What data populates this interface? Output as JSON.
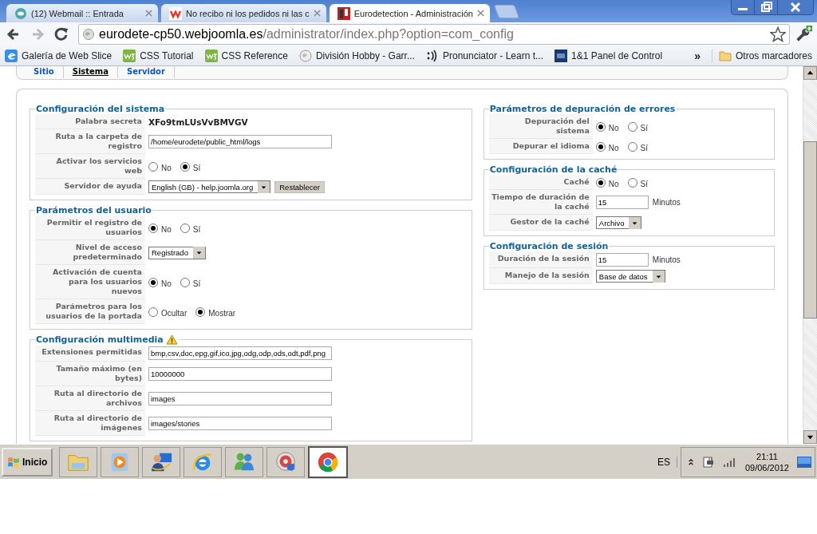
{
  "browser_tabs": [
    {
      "title": "(12) Webmail :: Entrada",
      "selected": false
    },
    {
      "title": "No recibo ni los pedidos ni las c",
      "selected": false
    },
    {
      "title": "Eurodetection - Administración",
      "selected": true
    }
  ],
  "address": {
    "host": "eurodete-cp50.webjoomla.es",
    "path": "/administrator/index.php?option=com_config"
  },
  "bookmarks": [
    {
      "label": "Galería de Web Slice"
    },
    {
      "label": "CSS Tutorial"
    },
    {
      "label": "CSS Reference"
    },
    {
      "label": "División Hobby - Garr..."
    },
    {
      "label": "Pronunciator - Learn t..."
    },
    {
      "label": "1&1 Panel de Control"
    }
  ],
  "bookmarks_overflow": "»",
  "other_bookmarks": "Otros marcadores",
  "config_tabs": [
    {
      "label": "Sitio",
      "selected": false
    },
    {
      "label": "Sistema",
      "selected": true
    },
    {
      "label": "Servidor",
      "selected": false
    }
  ],
  "left_sections": [
    {
      "title": "Configuración del sistema",
      "warning": false,
      "rows": [
        {
          "kind": "text",
          "label": "Palabra secreta",
          "value": "XFo9tmLUsVvBMVGV"
        },
        {
          "kind": "input",
          "label": "Ruta a la carpeta de registro",
          "value": "/home/eurodete/public_html/logs"
        },
        {
          "kind": "radio",
          "label": "Activar los servicios web",
          "options": [
            {
              "label": "No",
              "selected": false
            },
            {
              "label": "Sí",
              "selected": true
            }
          ]
        },
        {
          "kind": "select",
          "label": "Servidor de ayuda",
          "value": "English (GB) - help.joomla.org",
          "button": "Restablecer"
        }
      ]
    },
    {
      "title": "Parámetros del usuario",
      "warning": false,
      "rows": [
        {
          "kind": "radio",
          "label": "Permitir el registro de usuarios",
          "options": [
            {
              "label": "No",
              "selected": true
            },
            {
              "label": "Sí",
              "selected": false
            }
          ]
        },
        {
          "kind": "select",
          "label": "Nivel de acceso predeterminado",
          "value": "Registrado"
        },
        {
          "kind": "radio",
          "label": "Activación de cuenta para los usuarios nuevos",
          "options": [
            {
              "label": "No",
              "selected": true
            },
            {
              "label": "Sí",
              "selected": false
            }
          ]
        },
        {
          "kind": "radio",
          "label": "Parámetros para los usuarios de la portada",
          "options": [
            {
              "label": "Ocultar",
              "selected": false
            },
            {
              "label": "Mostrar",
              "selected": true
            }
          ]
        }
      ]
    },
    {
      "title": "Configuración multimedia",
      "warning": true,
      "rows": [
        {
          "kind": "input",
          "label": "Extensiones permitidas",
          "value": "bmp,csv,doc,epg,gif,ico,jpg,odg,odp,ods,odt,pdf,png"
        },
        {
          "kind": "input",
          "label": "Tamaño máximo (en bytes)",
          "value": "10000000"
        },
        {
          "kind": "input",
          "label": "Ruta al directorio de archivos",
          "value": "images"
        },
        {
          "kind": "input",
          "label": "Ruta al directorio de imágenes",
          "value": "images/stories"
        }
      ]
    }
  ],
  "right_sections": [
    {
      "title": "Parámetros de depuración de errores",
      "warning": false,
      "rows": [
        {
          "kind": "radio",
          "label": "Depuración del sistema",
          "options": [
            {
              "label": "No",
              "selected": true
            },
            {
              "label": "Sí",
              "selected": false
            }
          ]
        },
        {
          "kind": "radio",
          "label": "Depurar el idioma",
          "options": [
            {
              "label": "No",
              "selected": true
            },
            {
              "label": "Sí",
              "selected": false
            }
          ]
        }
      ]
    },
    {
      "title": "Configuración de la caché",
      "warning": false,
      "rows": [
        {
          "kind": "radio",
          "label": "Caché",
          "options": [
            {
              "label": "No",
              "selected": true
            },
            {
              "label": "Sí",
              "selected": false
            }
          ]
        },
        {
          "kind": "input",
          "label": "Tiempo de duración de la caché",
          "value": "15",
          "unit": "Minutos"
        },
        {
          "kind": "select",
          "label": "Gestor de la caché",
          "value": "Archivo"
        }
      ]
    },
    {
      "title": "Configuración de sesión",
      "warning": false,
      "rows": [
        {
          "kind": "input",
          "label": "Duración de la sesión",
          "value": "15",
          "unit": "Minutos"
        },
        {
          "kind": "select",
          "label": "Manejo de la sesión",
          "value": "Base de datos"
        }
      ]
    }
  ],
  "taskbar": {
    "start": "Inicio",
    "apps": [
      {
        "selected": false
      },
      {
        "selected": false
      },
      {
        "selected": false
      },
      {
        "selected": false
      },
      {
        "selected": false
      },
      {
        "selected": false
      },
      {
        "selected": true
      }
    ],
    "language": "ES",
    "time": "21:11",
    "date": "09/06/2012"
  }
}
